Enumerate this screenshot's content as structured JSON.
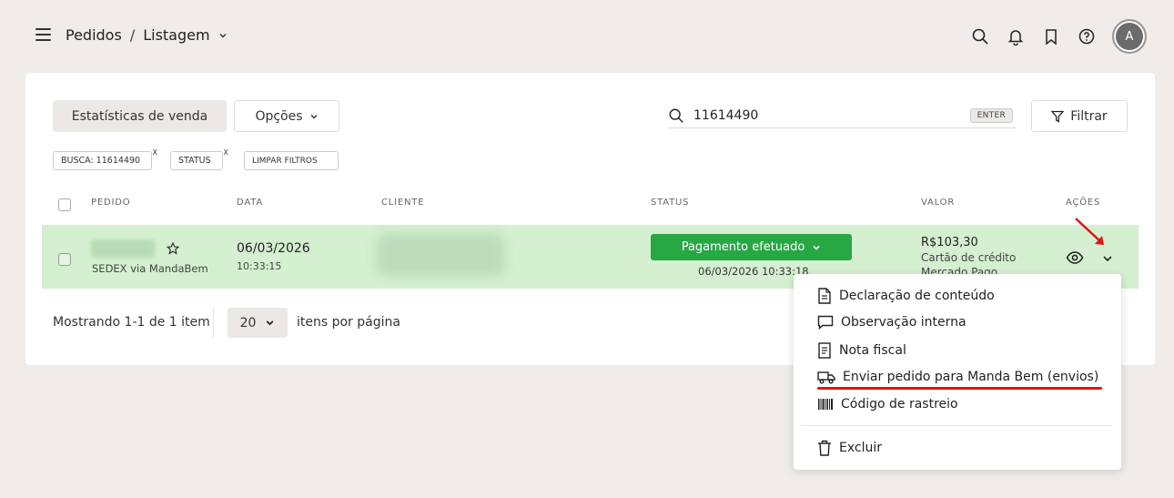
{
  "header": {
    "breadcrumb_section": "Pedidos",
    "breadcrumb_separator": "/",
    "breadcrumb_page": "Listagem",
    "avatar_initial": "A"
  },
  "toolbar": {
    "stats_label": "Estatísticas de venda",
    "options_label": "Opções",
    "search_value": "11614490",
    "enter_badge": "ENTER",
    "filter_label": "Filtrar"
  },
  "chips": {
    "busca": "BUSCA: 11614490",
    "status": "STATUS",
    "limpar": "LIMPAR FILTROS",
    "remove": "X"
  },
  "table": {
    "headers": {
      "pedido": "PEDIDO",
      "data": "DATA",
      "cliente": "CLIENTE",
      "status": "STATUS",
      "valor": "VALOR",
      "acoes": "AÇÕES"
    },
    "row": {
      "shipping": "SEDEX via MandaBem",
      "date": "06/03/2026",
      "time": "10:33:15",
      "status_label": "Pagamento efetuado",
      "status_datetime": "06/03/2026 10:33:18",
      "value": "R$103,30",
      "payment_method": "Cartão de crédito",
      "payment_provider": "Mercado Pago"
    }
  },
  "pagination": {
    "showing": "Mostrando 1-1 de 1 item",
    "per_page_value": "20",
    "per_page_label": "itens por página"
  },
  "actions_menu": {
    "items": [
      {
        "label": "Declaração de conteúdo",
        "icon": "document-icon"
      },
      {
        "label": "Observação interna",
        "icon": "comment-icon"
      },
      {
        "label": "Nota fiscal",
        "icon": "invoice-icon"
      },
      {
        "label": "Enviar pedido para Manda Bem (envios)",
        "icon": "truck-icon"
      },
      {
        "label": "Código de rastreio",
        "icon": "barcode-icon"
      }
    ],
    "delete_label": "Excluir"
  },
  "colors": {
    "background": "#efecea",
    "row_highlight": "#d4f0d0",
    "status_green": "#28a745",
    "annotation_red": "#e01616"
  }
}
